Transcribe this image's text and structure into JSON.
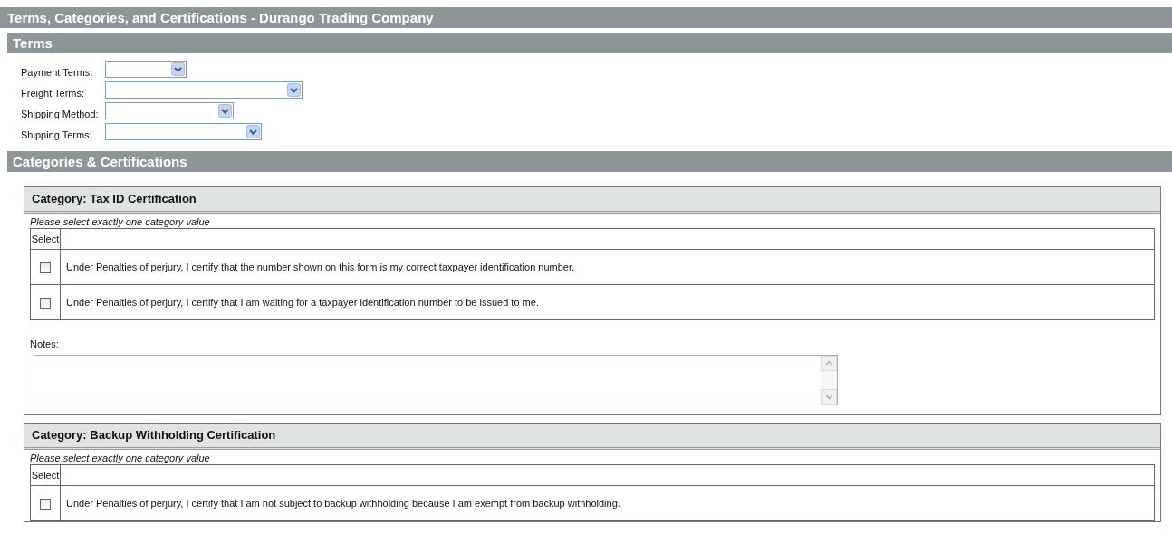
{
  "window": {
    "title": "Terms, Categories, and Certifications - Durango Trading Company"
  },
  "terms": {
    "heading": "Terms",
    "fields": [
      {
        "label": "Payment Terms:"
      },
      {
        "label": "Freight Terms:"
      },
      {
        "label": "Shipping Method:"
      },
      {
        "label": "Shipping Terms:"
      }
    ]
  },
  "categories": {
    "heading": "Categories & Certifications",
    "panels": [
      {
        "title": "Category: Tax ID Certification",
        "instruction": "Please select exactly one category value",
        "select_header": "Select",
        "options": [
          {
            "text": "Under Penalties of perjury, I certify that the number shown on this form is my correct taxpayer identification number.",
            "checked": false
          },
          {
            "text": "Under Penalties of perjury, I certify that I am waiting for a taxpayer identification number to be issued to me.",
            "checked": false
          }
        ],
        "notes_label": "Notes:"
      },
      {
        "title": "Category: Backup Withholding Certification",
        "instruction": "Please select exactly one category value",
        "select_header": "Select",
        "options": [
          {
            "text": "Under Penalties of perjury, I certify that I am not subject to backup withholding because I am exempt from backup withholding.",
            "checked": false
          }
        ]
      }
    ]
  }
}
